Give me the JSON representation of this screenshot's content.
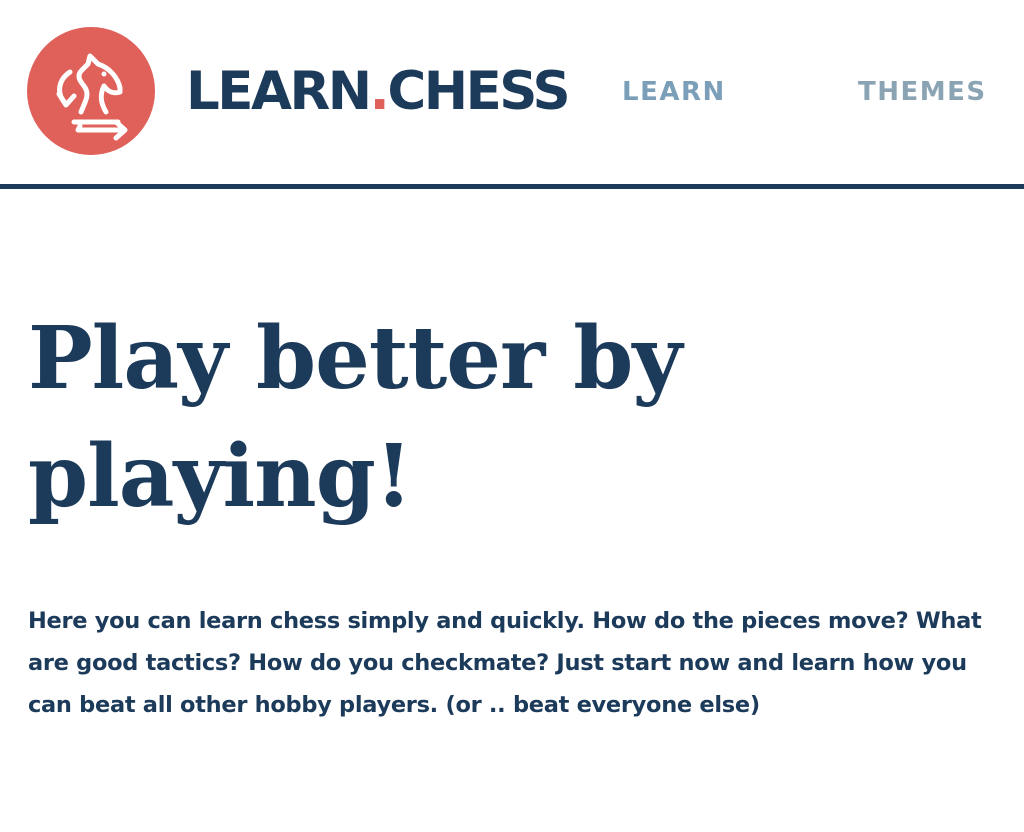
{
  "header": {
    "logo_icon": "knight-arrows-icon",
    "brand": {
      "part1": "LEARN",
      "dot": ".",
      "part2": "CHESS"
    },
    "nav": [
      {
        "label": "LEARN"
      },
      {
        "label": "THEMES"
      }
    ]
  },
  "hero": {
    "title": "Play better by playing!",
    "text": "Here you can learn chess simply and quickly. How do the pieces move? What are good tactics? How do you checkmate? Just start now and learn how you can beat all other hobby players. (or .. beat everyone else)"
  },
  "colors": {
    "primary": "#1c3a5a",
    "accent": "#e0605a",
    "nav": "#7b9fb8"
  }
}
